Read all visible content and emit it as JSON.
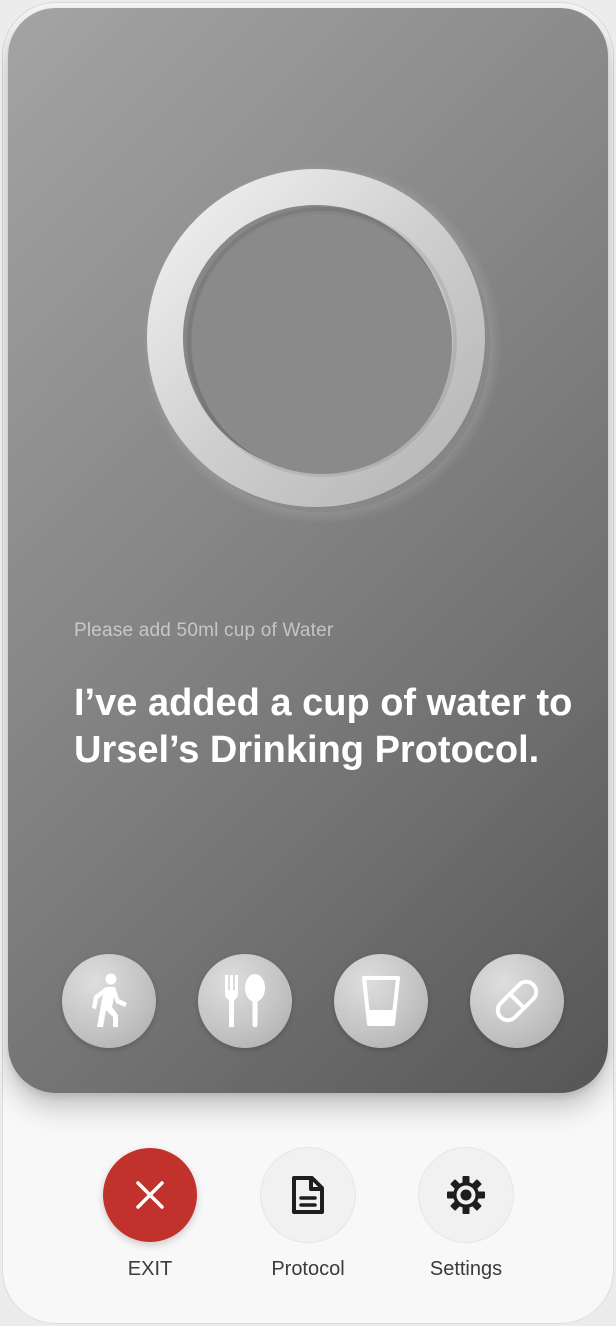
{
  "status": {
    "hint": "Please add 50ml cup of Water",
    "message": "I’ve added a cup of water to Ursel’s Drinking Protocol."
  },
  "categories": [
    {
      "icon": "walking-person-icon"
    },
    {
      "icon": "fork-spoon-icon"
    },
    {
      "icon": "drinking-glass-icon"
    },
    {
      "icon": "pill-icon"
    }
  ],
  "nav": {
    "exit_label": "EXIT",
    "protocol_label": "Protocol",
    "settings_label": "Settings"
  },
  "colors": {
    "exit_button": "#c1322d",
    "card_gradient_start": "#a4a4a4",
    "card_gradient_end": "#565656",
    "message_text": "#ffffff"
  }
}
